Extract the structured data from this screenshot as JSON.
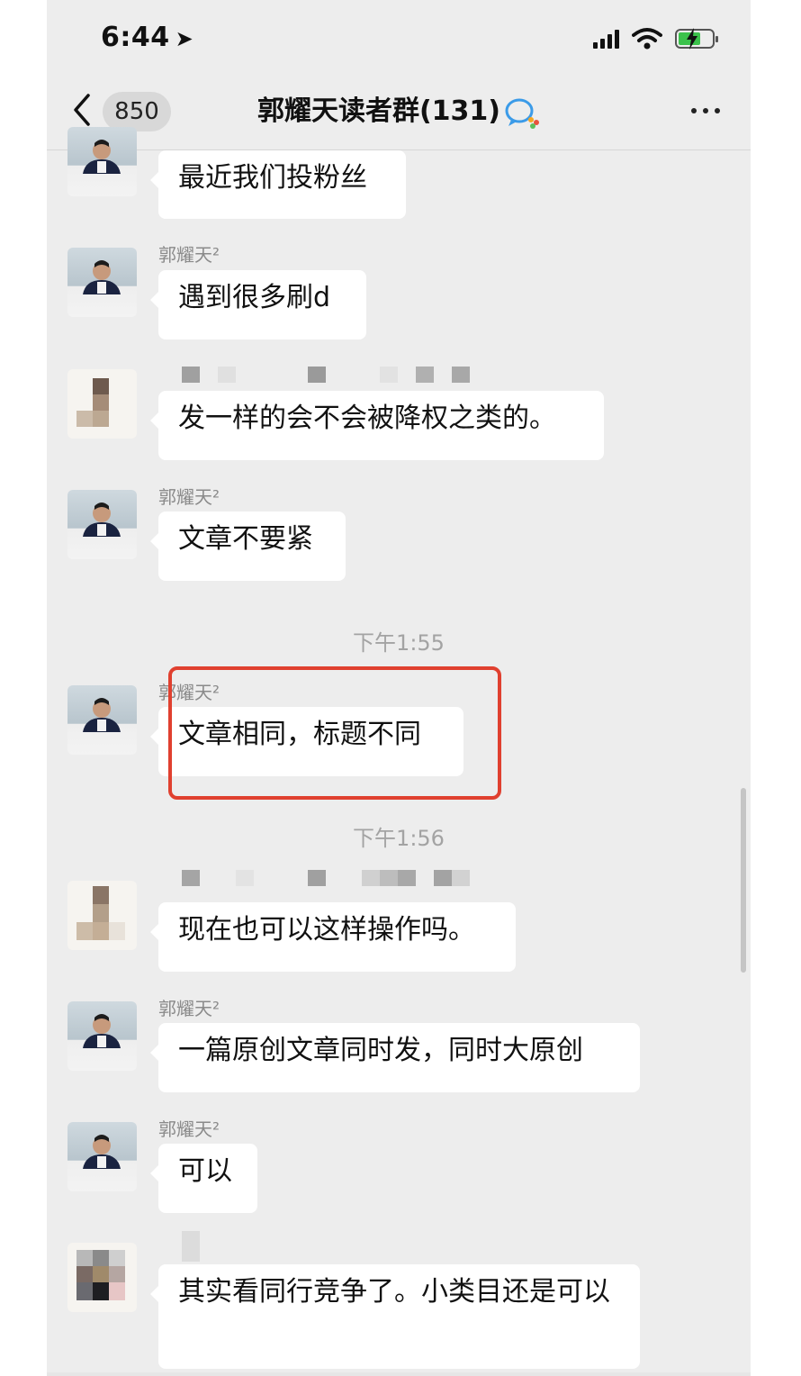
{
  "status_bar": {
    "time": "6:44",
    "location_icon": "location-arrow-icon",
    "battery_color": "#3bc24b"
  },
  "navbar": {
    "unread_count": "850",
    "title": "郭耀天读者群(131)",
    "more_icon": "ellipsis-icon"
  },
  "messages": [
    {
      "sender": "",
      "text": "最近我们投粉丝"
    },
    {
      "sender": "郭耀天²",
      "text": "遇到很多刷d"
    },
    {
      "sender": "",
      "text": "发一样的会不会被降权之类的。"
    },
    {
      "sender": "郭耀天²",
      "text": "文章不要紧"
    },
    {
      "timestamp": "下午1:55"
    },
    {
      "sender": "郭耀天²",
      "text": "文章相同，标题不同"
    },
    {
      "timestamp": "下午1:56"
    },
    {
      "sender": "",
      "text": "现在也可以这样操作吗。"
    },
    {
      "sender": "郭耀天²",
      "text": "一篇原创文章同时发，同时大原创"
    },
    {
      "sender": "郭耀天²",
      "text": "可以"
    },
    {
      "sender": "",
      "text": "其实看同行竞争了。小类目还是可以"
    }
  ],
  "highlight_color": "#e0402f"
}
